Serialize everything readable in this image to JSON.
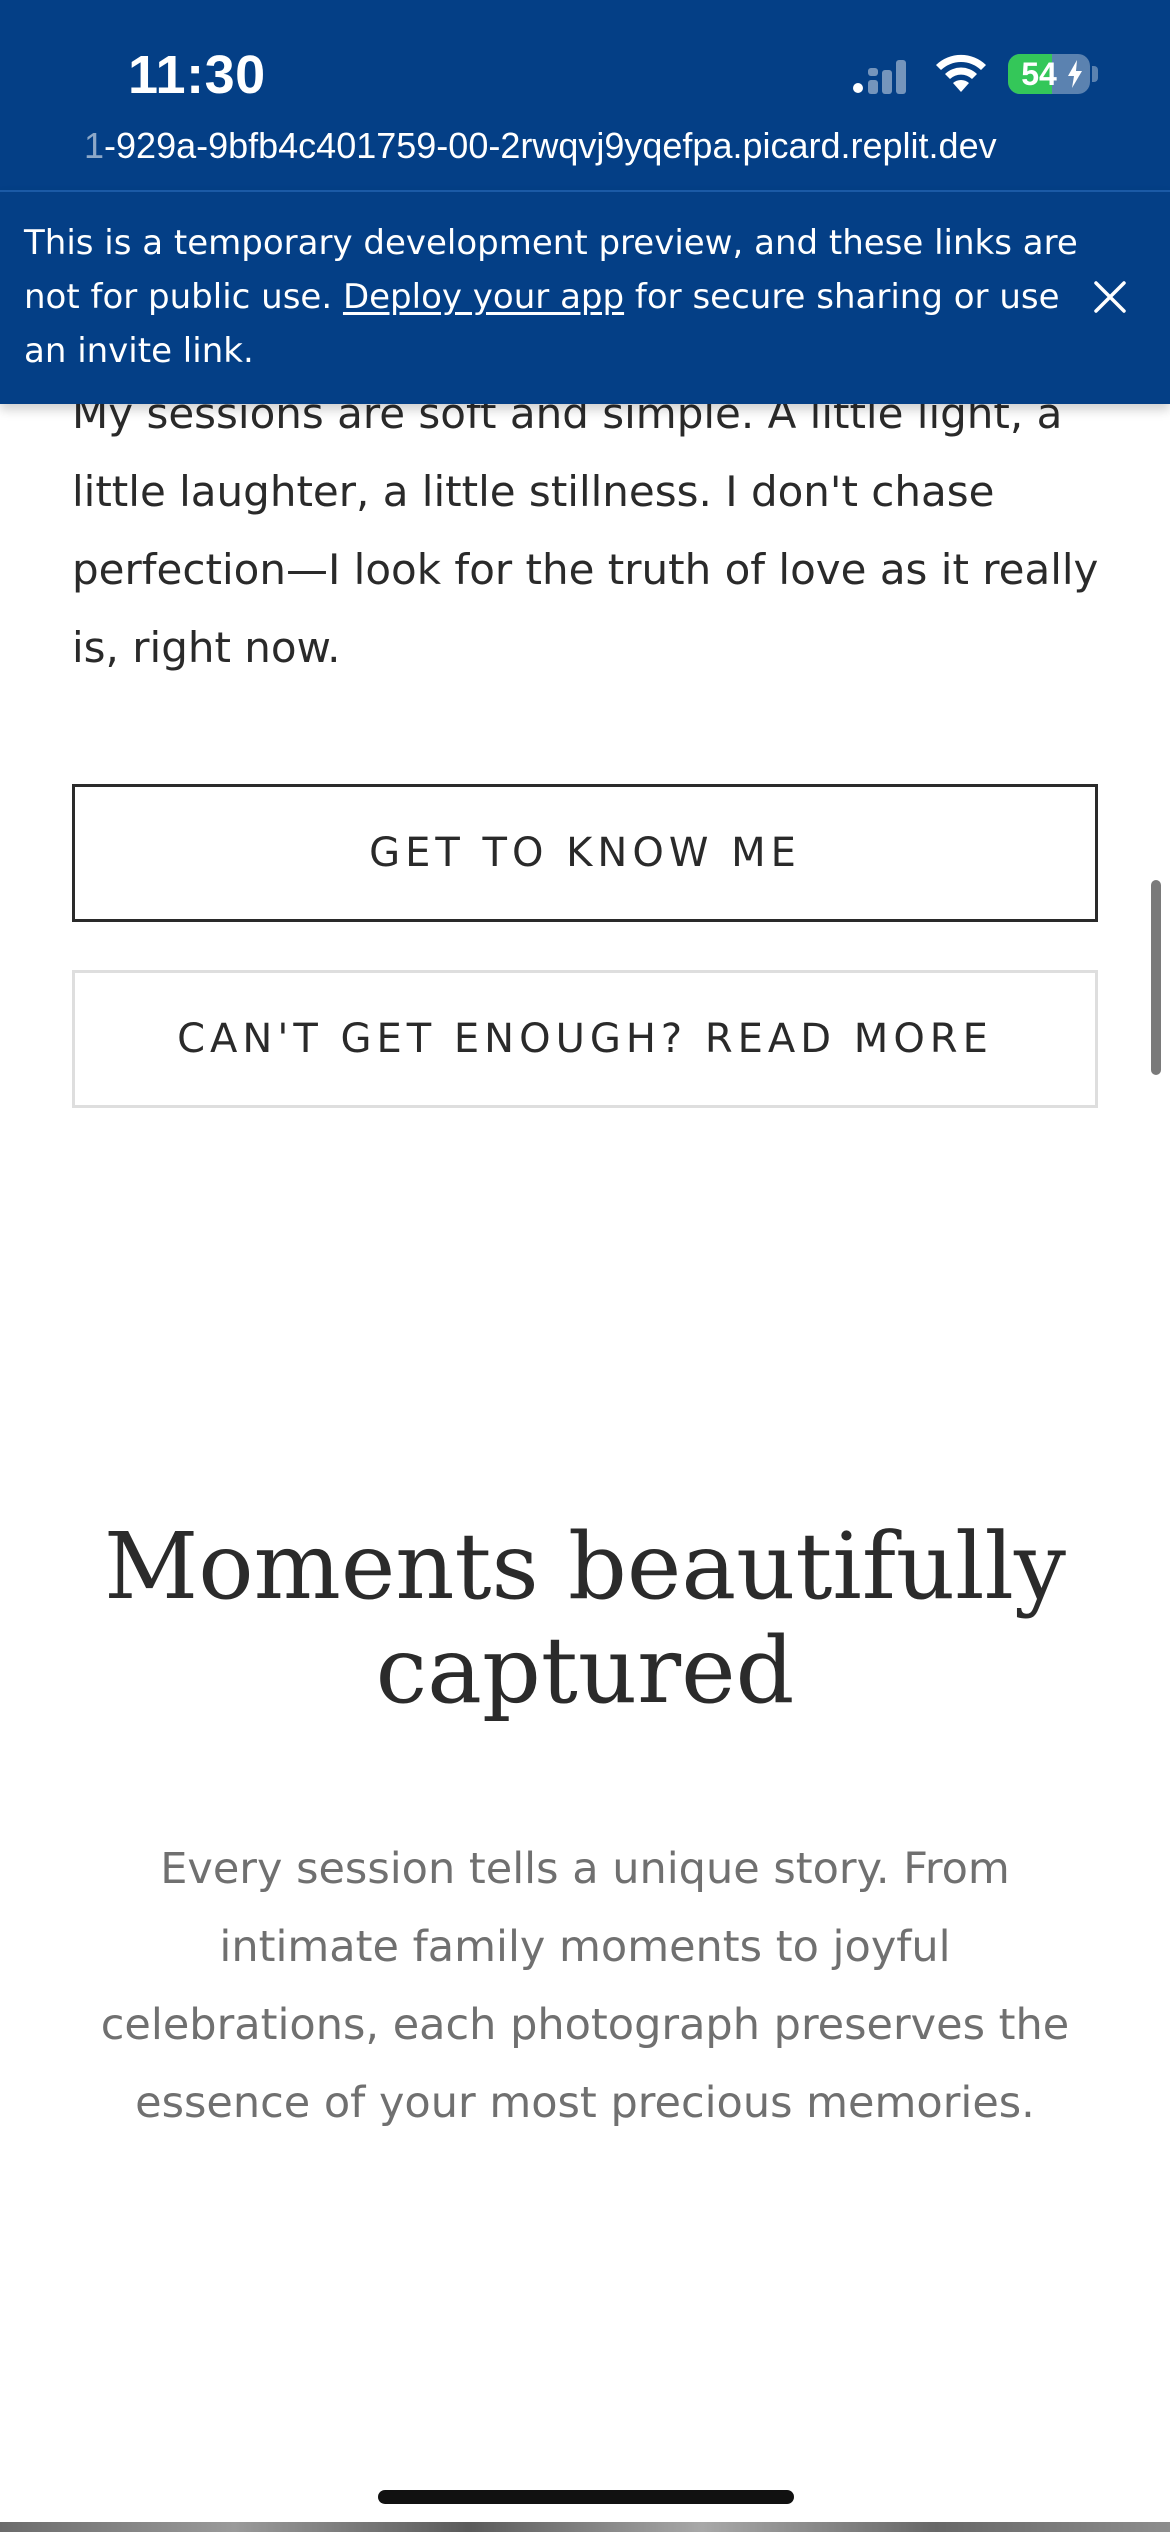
{
  "status_bar": {
    "time": "11:30",
    "battery_level": "54",
    "battery_fraction": 0.54,
    "battery_color": "#34c759",
    "charging": true,
    "signal_icon": "cellular-signal-icon",
    "wifi_icon": "wifi-icon"
  },
  "browser": {
    "url_prefix": "1",
    "url": "-929a-9bfb4c401759-00-2rwqvj9yqefpa.picard.replit.dev"
  },
  "banner": {
    "text_before_link": "This is a temporary development preview, and these links are not for public use. ",
    "link_text": "Deploy your app",
    "text_after_link": " for secure sharing or use an invite link.",
    "close_icon": "close-icon",
    "background_color": "#043f86"
  },
  "content": {
    "paragraph": "My sessions are soft and simple. A little light, a little laughter, a little stillness. I don't chase perfection—I look for the truth of love as it really is, right now.",
    "primary_button": "GET TO KNOW ME",
    "secondary_button": "CAN'T GET ENOUGH? READ MORE",
    "section_heading": "Moments beautifully captured",
    "section_description": "Every session tells a unique story. From intimate family moments to joyful celebrations, each photograph preserves the essence of your most precious memories."
  }
}
